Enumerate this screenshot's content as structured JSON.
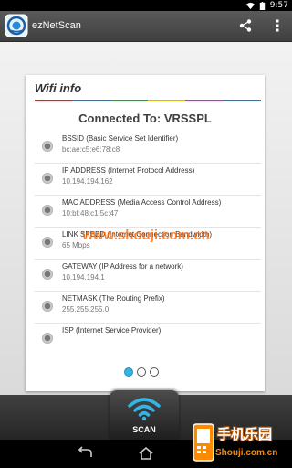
{
  "status_bar": {
    "time": "9:57"
  },
  "action_bar": {
    "title": "ezNetScan",
    "share_icon": "share-icon",
    "overflow_icon": "overflow-menu-icon"
  },
  "card": {
    "title": "Wifi info",
    "connected_to": "Connected To: VRSSPL",
    "stripe_colors": [
      "#cc2b2b",
      "#2b6fd0",
      "#2d9b3f",
      "#f2b100",
      "#a43fc8",
      "#2b6fd0"
    ],
    "items": [
      {
        "label": "BSSID (Basic Service Set Identifier)",
        "value": "bc:ae:c5:e6:78:c8"
      },
      {
        "label": "IP ADDRESS (Internet Protocol Address)",
        "value": "10.194.194.162"
      },
      {
        "label": "MAC ADDRESS (Media Access Control Address)",
        "value": "10:bf:48:c1:5c:47"
      },
      {
        "label": "LINK SPEED (Internet Connection Bandwidth)",
        "value": "65 Mbps"
      },
      {
        "label": "GATEWAY (IP Address for a network)",
        "value": "10.194.194.1"
      },
      {
        "label": "NETMASK (The Routing Prefix)",
        "value": "255.255.255.0"
      },
      {
        "label": "ISP (Internet Service Provider)",
        "value": ""
      }
    ]
  },
  "watermark": "www.shouji.com.cn",
  "page_indicator": {
    "count": 3,
    "active": 0
  },
  "scan_button": {
    "label": "SCAN"
  },
  "site_badge": {
    "line1": "手机乐园",
    "line2": "Shouji.com.cn"
  },
  "colors": {
    "accent": "#33b5e5",
    "watermark": "#ff6600"
  }
}
